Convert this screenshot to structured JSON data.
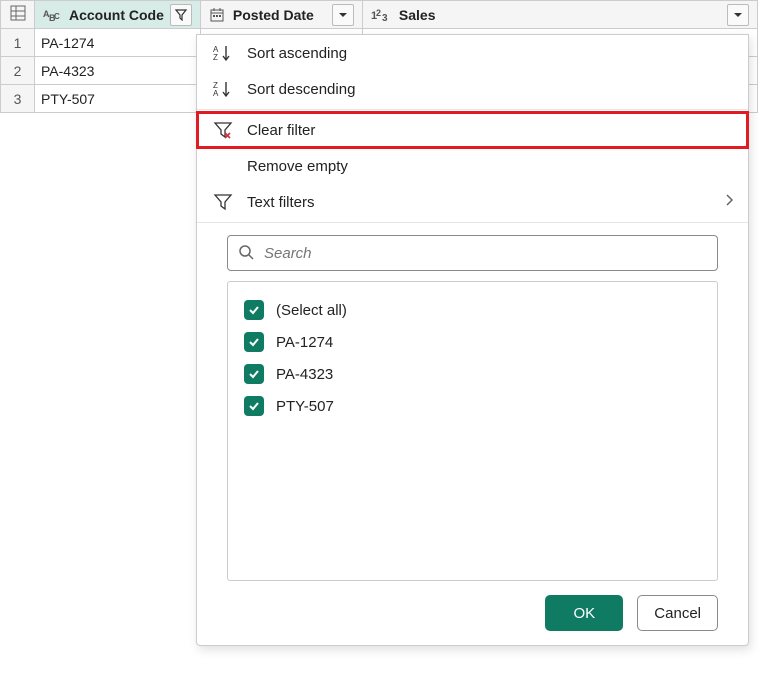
{
  "columns": [
    {
      "label": "Account Code",
      "type": "text",
      "filtered": true,
      "active": true
    },
    {
      "label": "Posted Date",
      "type": "date",
      "filtered": false,
      "active": false
    },
    {
      "label": "Sales",
      "type": "number",
      "filtered": false,
      "active": false
    }
  ],
  "rows": [
    {
      "n": "1",
      "account_code": "PA-1274"
    },
    {
      "n": "2",
      "account_code": "PA-4323"
    },
    {
      "n": "3",
      "account_code": "PTY-507"
    }
  ],
  "menu": {
    "sort_asc": "Sort ascending",
    "sort_desc": "Sort descending",
    "clear_filter": "Clear filter",
    "remove_empty": "Remove empty",
    "text_filters": "Text filters"
  },
  "search": {
    "placeholder": "Search"
  },
  "checklist": {
    "select_all": "(Select all)",
    "items": [
      "PA-1274",
      "PA-4323",
      "PTY-507"
    ]
  },
  "buttons": {
    "ok": "OK",
    "cancel": "Cancel"
  },
  "colors": {
    "accent": "#0f7b63",
    "highlight_border": "#e11b22"
  }
}
